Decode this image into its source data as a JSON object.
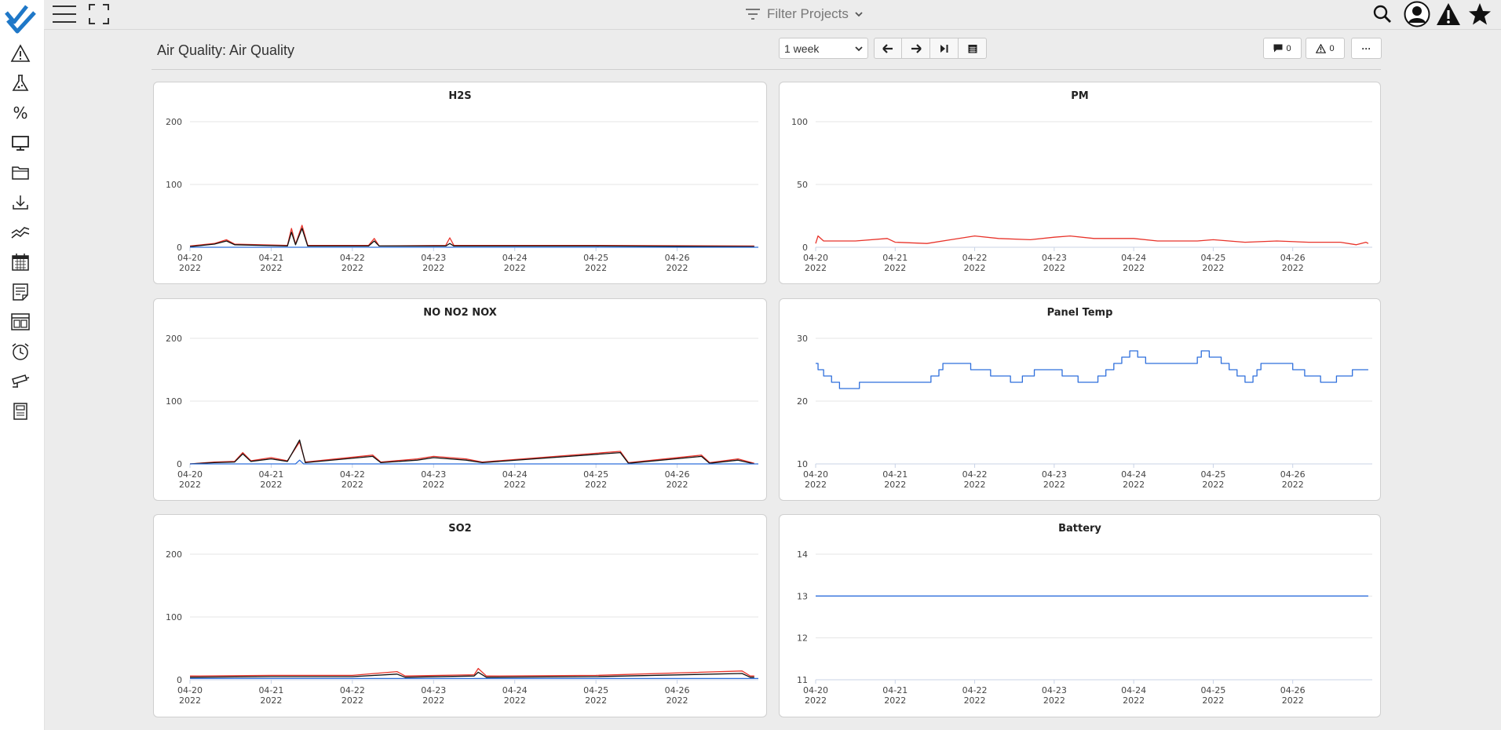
{
  "app": {
    "filter_label": "Filter Projects",
    "page_title": "Air Quality: Air Quality"
  },
  "sidebar": {
    "items": [
      {
        "name": "alerts",
        "icon": "warning-icon"
      },
      {
        "name": "lab",
        "icon": "flask-icon"
      },
      {
        "name": "percent",
        "icon": "percent-icon",
        "glyph": "%"
      },
      {
        "name": "display",
        "icon": "monitor-icon"
      },
      {
        "name": "files",
        "icon": "folder-icon"
      },
      {
        "name": "download",
        "icon": "download-icon"
      },
      {
        "name": "trends",
        "icon": "trend-icon"
      },
      {
        "name": "calendar",
        "icon": "calendar-icon"
      },
      {
        "name": "notes",
        "icon": "note-icon"
      },
      {
        "name": "dashboard",
        "icon": "layout-icon"
      },
      {
        "name": "history",
        "icon": "clock-icon"
      },
      {
        "name": "camera",
        "icon": "camera-icon"
      },
      {
        "name": "report",
        "icon": "book-icon"
      }
    ]
  },
  "toolbar": {
    "range_value": "1 week",
    "comments_count": "0",
    "alerts_count": "0",
    "more_label": "···"
  },
  "colors": {
    "red": "#e8332a",
    "black": "#111111",
    "blue": "#2f6fdc",
    "grid": "#e6e6e6",
    "axis": "#c9d3e6"
  },
  "chart_data": [
    {
      "type": "line",
      "title": "H2S",
      "x": [
        "04-20 2022",
        "04-21 2022",
        "04-22 2022",
        "04-23 2022",
        "04-24 2022",
        "04-25 2022",
        "04-26 2022"
      ],
      "xlim": [
        0,
        7
      ],
      "ylim": [
        0,
        200
      ],
      "yticks": [
        "0",
        "100",
        "200"
      ],
      "series": [
        {
          "color": "red",
          "points": [
            [
              0,
              2
            ],
            [
              0.3,
              6
            ],
            [
              0.45,
              12
            ],
            [
              0.55,
              5
            ],
            [
              1.2,
              3
            ],
            [
              1.25,
              30
            ],
            [
              1.3,
              5
            ],
            [
              1.38,
              35
            ],
            [
              1.45,
              3
            ],
            [
              2.2,
              3
            ],
            [
              2.27,
              14
            ],
            [
              2.33,
              2
            ],
            [
              3.15,
              3
            ],
            [
              3.2,
              15
            ],
            [
              3.25,
              3
            ],
            [
              5,
              3
            ],
            [
              6.95,
              2
            ]
          ]
        },
        {
          "color": "black",
          "points": [
            [
              0,
              1
            ],
            [
              0.3,
              5
            ],
            [
              0.45,
              10
            ],
            [
              0.55,
              4
            ],
            [
              1.2,
              2
            ],
            [
              1.25,
              24
            ],
            [
              1.3,
              4
            ],
            [
              1.38,
              30
            ],
            [
              1.45,
              2
            ],
            [
              2.2,
              2
            ],
            [
              2.27,
              10
            ],
            [
              2.33,
              2
            ],
            [
              3.15,
              2
            ],
            [
              3.2,
              6
            ],
            [
              3.25,
              2
            ],
            [
              5,
              2
            ],
            [
              6.95,
              1
            ]
          ]
        },
        {
          "color": "blue",
          "points": [
            [
              0,
              0
            ],
            [
              7,
              0
            ]
          ]
        }
      ]
    },
    {
      "type": "line",
      "title": "PM",
      "x": [
        "04-20 2022",
        "04-21 2022",
        "04-22 2022",
        "04-23 2022",
        "04-24 2022",
        "04-25 2022",
        "04-26 2022"
      ],
      "xlim": [
        0,
        7
      ],
      "ylim": [
        0,
        100
      ],
      "yticks": [
        "0",
        "50",
        "100"
      ],
      "series": [
        {
          "color": "red",
          "points": [
            [
              0,
              3
            ],
            [
              0.03,
              9
            ],
            [
              0.1,
              5
            ],
            [
              0.5,
              5
            ],
            [
              0.9,
              7
            ],
            [
              1.0,
              4
            ],
            [
              1.4,
              3
            ],
            [
              1.7,
              6
            ],
            [
              2.0,
              9
            ],
            [
              2.3,
              7
            ],
            [
              2.7,
              6
            ],
            [
              3.0,
              8
            ],
            [
              3.2,
              9
            ],
            [
              3.5,
              7
            ],
            [
              4.0,
              7
            ],
            [
              4.3,
              5
            ],
            [
              4.8,
              5
            ],
            [
              5.0,
              6
            ],
            [
              5.4,
              4
            ],
            [
              5.8,
              5
            ],
            [
              6.2,
              4
            ],
            [
              6.6,
              4
            ],
            [
              6.8,
              2
            ],
            [
              6.92,
              4
            ],
            [
              6.95,
              3
            ]
          ]
        }
      ]
    },
    {
      "type": "line",
      "title": "NO NO2 NOX",
      "x": [
        "04-20 2022",
        "04-21 2022",
        "04-22 2022",
        "04-23 2022",
        "04-24 2022",
        "04-25 2022",
        "04-26 2022"
      ],
      "xlim": [
        0,
        7
      ],
      "ylim": [
        0,
        200
      ],
      "yticks": [
        "0",
        "100",
        "200"
      ],
      "series": [
        {
          "color": "red",
          "points": [
            [
              0,
              0
            ],
            [
              0.3,
              3
            ],
            [
              0.55,
              4
            ],
            [
              0.65,
              18
            ],
            [
              0.75,
              5
            ],
            [
              1.0,
              10
            ],
            [
              1.2,
              5
            ],
            [
              1.35,
              35
            ],
            [
              1.42,
              3
            ],
            [
              2.25,
              14
            ],
            [
              2.35,
              3
            ],
            [
              2.8,
              8
            ],
            [
              3.0,
              12
            ],
            [
              3.4,
              8
            ],
            [
              3.6,
              3
            ],
            [
              5.3,
              20
            ],
            [
              5.4,
              2
            ],
            [
              6.3,
              14
            ],
            [
              6.4,
              2
            ],
            [
              6.75,
              8
            ],
            [
              6.95,
              1
            ]
          ]
        },
        {
          "color": "black",
          "points": [
            [
              0,
              0
            ],
            [
              0.3,
              2
            ],
            [
              0.55,
              3
            ],
            [
              0.65,
              16
            ],
            [
              0.75,
              4
            ],
            [
              1.0,
              8
            ],
            [
              1.2,
              4
            ],
            [
              1.35,
              38
            ],
            [
              1.42,
              2
            ],
            [
              2.25,
              12
            ],
            [
              2.35,
              2
            ],
            [
              2.8,
              6
            ],
            [
              3.0,
              10
            ],
            [
              3.4,
              6
            ],
            [
              3.6,
              2
            ],
            [
              5.3,
              18
            ],
            [
              5.4,
              1
            ],
            [
              6.3,
              12
            ],
            [
              6.4,
              1
            ],
            [
              6.75,
              6
            ],
            [
              6.95,
              0
            ]
          ]
        },
        {
          "color": "blue",
          "points": [
            [
              0,
              0
            ],
            [
              1.3,
              0
            ],
            [
              1.35,
              6
            ],
            [
              1.4,
              0
            ],
            [
              7,
              0
            ]
          ]
        }
      ]
    },
    {
      "type": "line",
      "title": "Panel Temp",
      "x": [
        "04-20 2022",
        "04-21 2022",
        "04-22 2022",
        "04-23 2022",
        "04-24 2022",
        "04-25 2022",
        "04-26 2022"
      ],
      "xlim": [
        0,
        7
      ],
      "ylim": [
        10,
        30
      ],
      "yticks": [
        "10",
        "20",
        "30"
      ],
      "series": [
        {
          "color": "blue",
          "step": true,
          "points": [
            [
              0,
              26
            ],
            [
              0.03,
              25
            ],
            [
              0.1,
              24
            ],
            [
              0.2,
              23
            ],
            [
              0.3,
              22
            ],
            [
              0.55,
              23
            ],
            [
              1.45,
              24
            ],
            [
              1.55,
              25
            ],
            [
              1.6,
              26
            ],
            [
              1.95,
              25
            ],
            [
              2.2,
              24
            ],
            [
              2.45,
              23
            ],
            [
              2.6,
              24
            ],
            [
              2.75,
              25
            ],
            [
              3.1,
              24
            ],
            [
              3.3,
              23
            ],
            [
              3.55,
              24
            ],
            [
              3.65,
              25
            ],
            [
              3.75,
              26
            ],
            [
              3.85,
              27
            ],
            [
              3.95,
              28
            ],
            [
              4.05,
              27
            ],
            [
              4.15,
              26
            ],
            [
              4.8,
              27
            ],
            [
              4.85,
              28
            ],
            [
              4.95,
              27
            ],
            [
              5.1,
              26
            ],
            [
              5.2,
              25
            ],
            [
              5.3,
              24
            ],
            [
              5.4,
              23
            ],
            [
              5.5,
              24
            ],
            [
              5.55,
              25
            ],
            [
              5.6,
              26
            ],
            [
              6.0,
              25
            ],
            [
              6.15,
              24
            ],
            [
              6.35,
              23
            ],
            [
              6.55,
              24
            ],
            [
              6.75,
              25
            ],
            [
              6.95,
              25
            ]
          ]
        }
      ]
    },
    {
      "type": "line",
      "title": "SO2",
      "x": [
        "04-20 2022",
        "04-21 2022",
        "04-22 2022",
        "04-23 2022",
        "04-24 2022",
        "04-25 2022",
        "04-26 2022"
      ],
      "xlim": [
        0,
        7
      ],
      "ylim": [
        0,
        200
      ],
      "yticks": [
        "0",
        "100",
        "200"
      ],
      "series": [
        {
          "color": "red",
          "points": [
            [
              0,
              6
            ],
            [
              1,
              7
            ],
            [
              2,
              7
            ],
            [
              2.55,
              13
            ],
            [
              2.65,
              6
            ],
            [
              3.5,
              8
            ],
            [
              3.55,
              18
            ],
            [
              3.65,
              6
            ],
            [
              5,
              7
            ],
            [
              6.8,
              14
            ],
            [
              6.9,
              6
            ],
            [
              6.95,
              6
            ]
          ]
        },
        {
          "color": "black",
          "points": [
            [
              0,
              4
            ],
            [
              1,
              5
            ],
            [
              2,
              5
            ],
            [
              2.55,
              9
            ],
            [
              2.65,
              4
            ],
            [
              3.5,
              6
            ],
            [
              3.55,
              12
            ],
            [
              3.65,
              4
            ],
            [
              5,
              5
            ],
            [
              6.8,
              10
            ],
            [
              6.9,
              4
            ],
            [
              6.95,
              4
            ]
          ]
        },
        {
          "color": "blue",
          "points": [
            [
              0,
              2
            ],
            [
              7,
              2
            ]
          ]
        }
      ]
    },
    {
      "type": "line",
      "title": "Battery",
      "x": [
        "04-20 2022",
        "04-21 2022",
        "04-22 2022",
        "04-23 2022",
        "04-24 2022",
        "04-25 2022",
        "04-26 2022"
      ],
      "xlim": [
        0,
        7
      ],
      "ylim": [
        11,
        14
      ],
      "yticks": [
        "11",
        "12",
        "13",
        "14"
      ],
      "series": [
        {
          "color": "blue",
          "points": [
            [
              0,
              13
            ],
            [
              6.95,
              13
            ]
          ]
        }
      ]
    }
  ]
}
